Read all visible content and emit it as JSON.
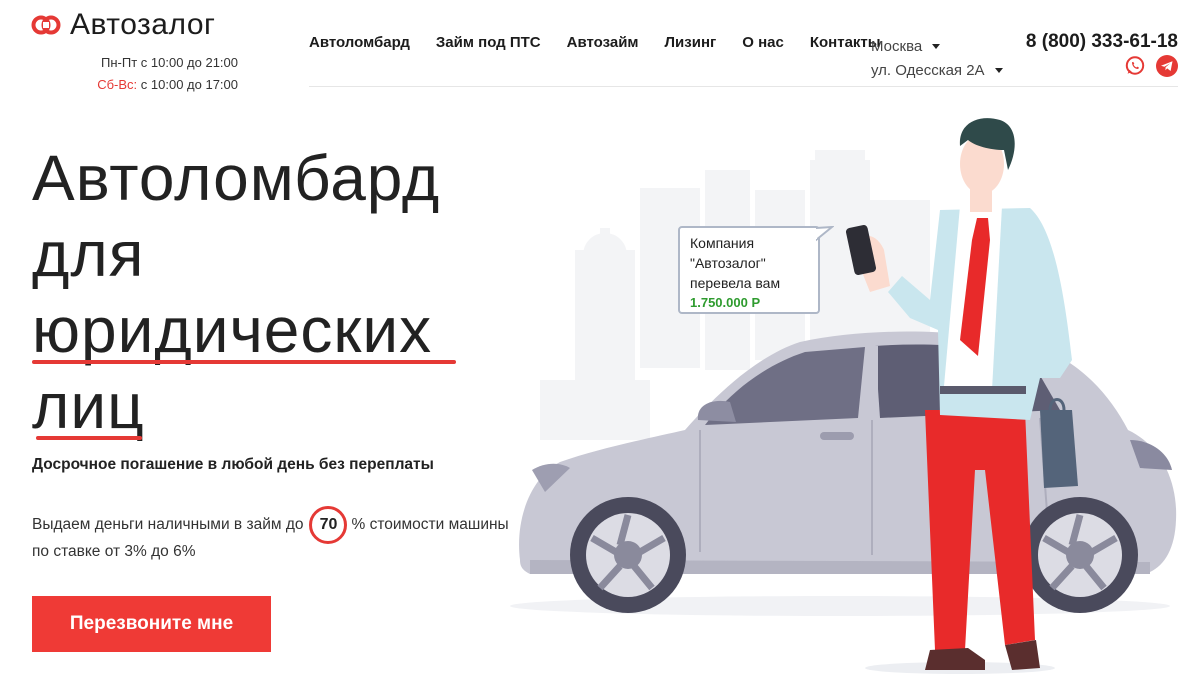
{
  "brand": {
    "name": "Автозалог",
    "logo_icon": "chain-link-icon",
    "accent": "#e53935"
  },
  "hours": {
    "weekdays": "Пн-Пт с 10:00 до 21:00",
    "weekend_label": "Сб-Вс:",
    "weekend_time": "с 10:00 до 17:00"
  },
  "nav": {
    "items": [
      "Автоломбард",
      "Займ под ПТС",
      "Автозайм",
      "Лизинг",
      "О нас",
      "Контакты"
    ]
  },
  "location": {
    "city": "Москва",
    "address": "ул. Одесская 2А"
  },
  "contact": {
    "phone": "8 (800) 333-61-18",
    "icons": [
      "whatsapp-icon",
      "telegram-icon"
    ]
  },
  "hero": {
    "title_lines": [
      "Автоломбард",
      "для",
      "юридических",
      "лиц"
    ],
    "subtitle": "Досрочное погашение в любой день без переплаты",
    "desc_before": "Выдаем деньги наличными в займ до",
    "percent": "70",
    "desc_after": "% стоимости машины",
    "desc_line2": "по ставке от 3% до 6%",
    "cta": "Перезвоните мне",
    "cta_color": "#ef3a36"
  },
  "bubble": {
    "line1": "Компания",
    "line2": "\"Автозалог\"",
    "line3": "перевела вам",
    "amount": "1.750.000 Р"
  }
}
